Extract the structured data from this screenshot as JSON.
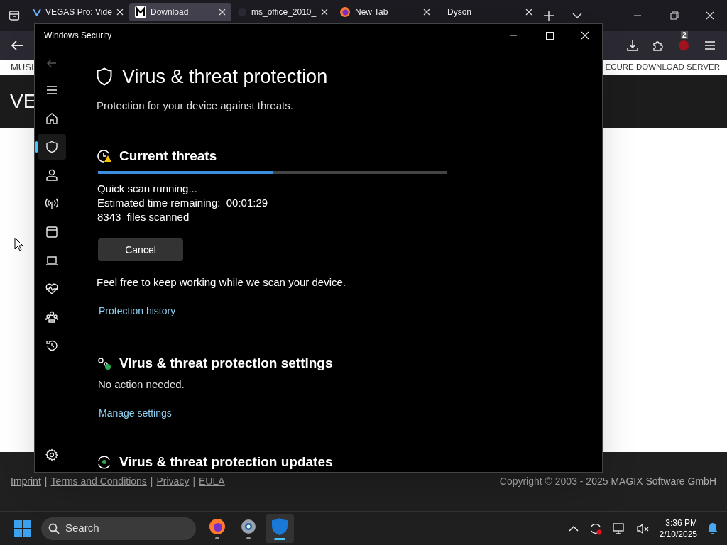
{
  "browser": {
    "tabs": [
      {
        "label": "VEGAS Pro: Vide",
        "kind": "v",
        "selected": false
      },
      {
        "label": "Download",
        "kind": "m",
        "selected": true
      },
      {
        "label": "ms_office_2010_",
        "kind": "dim",
        "selected": false
      },
      {
        "label": "New Tab",
        "kind": "firefox",
        "selected": false
      },
      {
        "label": "Dyson",
        "kind": "none",
        "selected": false
      }
    ],
    "extension_badge": "2",
    "page": {
      "menu_left": "MUSI",
      "menu_right": "ECURE DOWNLOAD SERVER",
      "header_text": "VE",
      "footer_links": [
        {
          "kind": "link",
          "text": "Imprint"
        },
        {
          "kind": "separator",
          "text": "|"
        },
        {
          "kind": "link",
          "text": "Terms and Conditions"
        },
        {
          "kind": "separator",
          "text": "|"
        },
        {
          "kind": "link",
          "text": "Privacy"
        },
        {
          "kind": "separator",
          "text": "|"
        },
        {
          "kind": "link",
          "text": "EULA"
        }
      ],
      "copyright": "Copyright © 2003 - 2025 MAGIX Software GmbH"
    }
  },
  "security_window": {
    "title": "Windows Security",
    "nav": [
      {
        "kind": "menu",
        "selected": false
      },
      {
        "kind": "home",
        "selected": false
      },
      {
        "kind": "shield",
        "selected": true
      },
      {
        "kind": "account",
        "selected": false
      },
      {
        "kind": "network",
        "selected": false
      },
      {
        "kind": "app",
        "selected": false
      },
      {
        "kind": "device",
        "selected": false
      },
      {
        "kind": "health",
        "selected": false
      },
      {
        "kind": "family",
        "selected": false
      },
      {
        "kind": "history",
        "selected": false
      }
    ],
    "heading": "Virus & threat protection",
    "subtitle": "Protection for your device against threats.",
    "current_threats": {
      "heading": "Current threats",
      "level": 0.5,
      "lines": [
        "Quick scan running...",
        "Estimated time remaining:  00:01:29",
        "8343  files scanned"
      ],
      "button": "Cancel",
      "note": "Feel free to keep working while we scan your device.",
      "link": "Protection history"
    },
    "settings": {
      "heading": "Virus & threat protection settings",
      "status": "No action needed.",
      "link": "Manage settings"
    },
    "updates": {
      "heading": "Virus & threat protection updates"
    }
  },
  "taskbar": {
    "search": "Search",
    "apps": [
      {
        "kind": "firefox",
        "active": false
      },
      {
        "kind": "settings",
        "active": false
      },
      {
        "kind": "security",
        "active": true
      }
    ],
    "time": "3:36 PM",
    "date": "2/10/2025"
  }
}
